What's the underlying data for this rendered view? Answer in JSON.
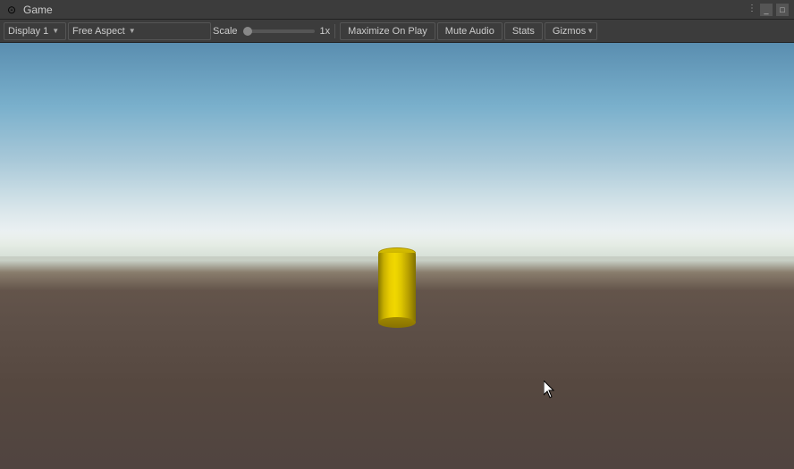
{
  "titlebar": {
    "icon": "⊙",
    "title": "Game",
    "menu_dots": "⋮",
    "minimize": "_",
    "maximize": "□"
  },
  "toolbar": {
    "display_label": "Display 1",
    "aspect_label": "Free Aspect",
    "scale_label": "Scale",
    "scale_value": "1x",
    "maximize_label": "Maximize On Play",
    "mute_label": "Mute Audio",
    "stats_label": "Stats",
    "gizmos_label": "Gizmos"
  },
  "viewport": {
    "description": "3D game view with yellow cylinder on ground"
  }
}
